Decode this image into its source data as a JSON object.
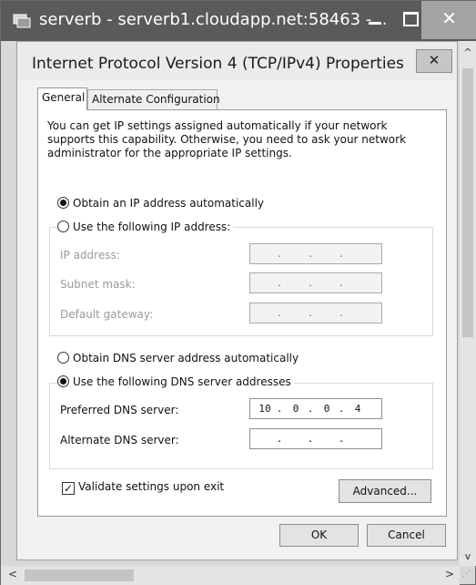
{
  "window": {
    "title": "serverb - serverb1.cloudapp.net:58463 -...",
    "close_glyph": "✕"
  },
  "dialog": {
    "title": "Internet Protocol Version 4 (TCP/IPv4) Properties",
    "close_glyph": "✕"
  },
  "tabs": [
    {
      "label": "General",
      "active": true
    },
    {
      "label": "Alternate Configuration",
      "active": false
    }
  ],
  "description": "You can get IP settings assigned automatically if your network supports this capability. Otherwise, you need to ask your network administrator for the appropriate IP settings.",
  "ip_section": {
    "auto_label": "Obtain an IP address automatically",
    "manual_label": "Use the following IP address:",
    "selected": "auto",
    "fields": [
      {
        "label": "IP address:",
        "octets": [
          "",
          "",
          "",
          ""
        ]
      },
      {
        "label": "Subnet mask:",
        "octets": [
          "",
          "",
          "",
          ""
        ]
      },
      {
        "label": "Default gateway:",
        "octets": [
          "",
          "",
          "",
          ""
        ]
      }
    ]
  },
  "dns_section": {
    "auto_label": "Obtain DNS server address automatically",
    "manual_label": "Use the following DNS server addresses",
    "selected": "manual",
    "fields": [
      {
        "label": "Preferred DNS server:",
        "octets": [
          "10",
          "0",
          "0",
          "4"
        ]
      },
      {
        "label": "Alternate DNS server:",
        "octets": [
          "",
          "",
          "",
          ""
        ]
      }
    ]
  },
  "validate": {
    "label": "Validate settings upon exit",
    "checked": true,
    "glyph": "✓"
  },
  "buttons": {
    "advanced": "Advanced...",
    "ok": "OK",
    "cancel": "Cancel"
  },
  "scroll": {
    "up": "^",
    "down": "v",
    "left": "<",
    "right": ">"
  }
}
